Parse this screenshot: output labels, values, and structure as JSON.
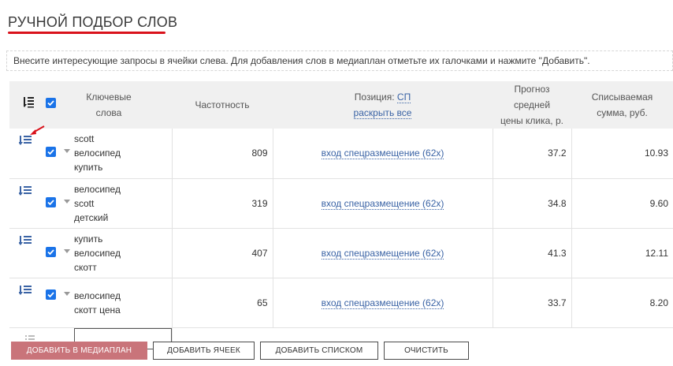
{
  "page": {
    "title": "РУЧНОЙ ПОДБОР СЛОВ",
    "info": "Внесите интересующие запросы в ячейки слева. Для добавления слов в медиаплан отметьте их галочками и нажмите \"Добавить\"."
  },
  "table": {
    "headers": {
      "keywords_line1": "Ключевые",
      "keywords_line2": "слова",
      "frequency": "Частотность",
      "position_label": "Позиция:",
      "position_value": "СП",
      "expand_all": "раскрыть все",
      "forecast_line1": "Прогноз средней",
      "forecast_line2": "цены клика, р.",
      "charge_line1": "Списываемая",
      "charge_line2": "сумма, руб."
    },
    "rows": [
      {
        "kw": [
          "scott",
          "велосипед",
          "купить"
        ],
        "freq": "809",
        "position": "вход спецразмещение (62x)",
        "forecast": "37.2",
        "charge": "10.93",
        "checked": true
      },
      {
        "kw": [
          "велосипед",
          "scott",
          "детский"
        ],
        "freq": "319",
        "position": "вход спецразмещение (62x)",
        "forecast": "34.8",
        "charge": "9.60",
        "checked": true
      },
      {
        "kw": [
          "купить",
          "велосипед",
          "скотт"
        ],
        "freq": "407",
        "position": "вход спецразмещение (62x)",
        "forecast": "41.3",
        "charge": "12.11",
        "checked": true
      },
      {
        "kw": [
          "велосипед",
          "скотт цена"
        ],
        "freq": "65",
        "position": "вход спецразмещение (62x)",
        "forecast": "33.7",
        "charge": "8.20",
        "checked": true
      }
    ],
    "new_row_value": ""
  },
  "buttons": {
    "add_to_mediaplan": "добавить в медиаплан",
    "add_cells": "добавить ячеек",
    "add_list": "добавить списком",
    "clear": "очистить"
  },
  "colors": {
    "accent": "#d9121b",
    "checkbox": "#1a73e8",
    "link": "#3a63a5",
    "primary_button": "#c9747a",
    "header_bg": "#f0f0f0"
  }
}
